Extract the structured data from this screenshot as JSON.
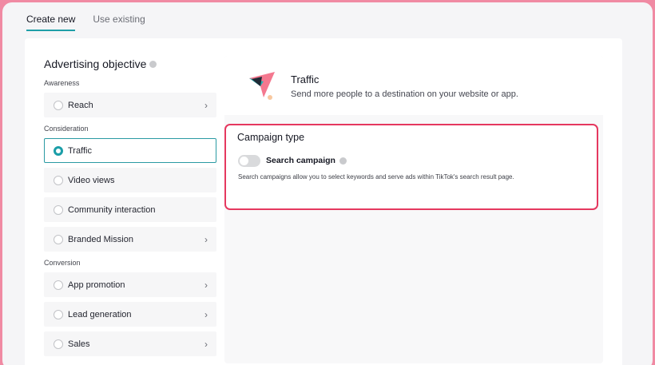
{
  "tabs": [
    {
      "label": "Create new",
      "active": true
    },
    {
      "label": "Use existing",
      "active": false
    }
  ],
  "objective": {
    "title": "Advertising objective",
    "sections": {
      "awareness": "Awareness",
      "consideration": "Consideration",
      "conversion": "Conversion"
    },
    "options": {
      "reach": "Reach",
      "traffic": "Traffic",
      "video_views": "Video views",
      "community_interaction": "Community interaction",
      "branded_mission": "Branded Mission",
      "app_promotion": "App promotion",
      "lead_generation": "Lead generation",
      "sales": "Sales"
    },
    "selected": "Traffic"
  },
  "detail": {
    "title": "Traffic",
    "description": "Send more people to a destination on your website or app."
  },
  "campaign_type": {
    "title": "Campaign type",
    "toggle_label": "Search campaign",
    "toggle_on": false,
    "description": "Search campaigns allow you to select keywords and serve ads within TikTok's search result page."
  },
  "colors": {
    "highlight": "#e5385f",
    "accent": "#1b9ea8",
    "background": "#f08aa3"
  },
  "chevron": "›"
}
